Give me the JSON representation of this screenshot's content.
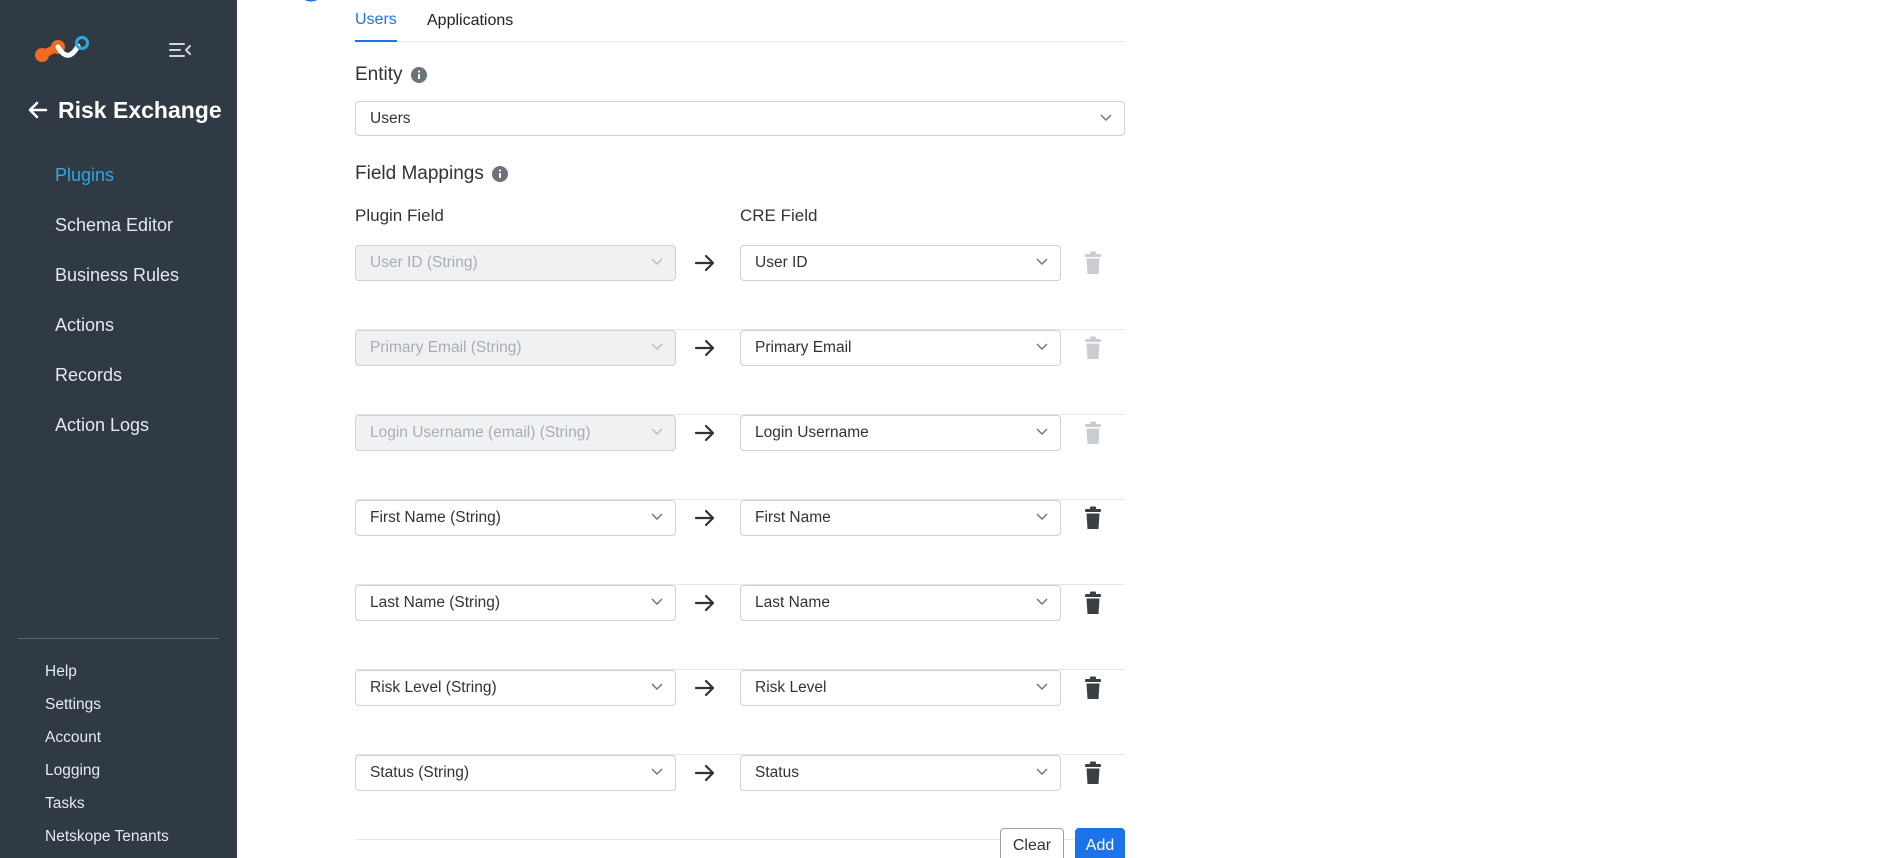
{
  "sidebar": {
    "section_title": "Risk Exchange",
    "nav_items": [
      {
        "label": "Plugins",
        "active": true
      },
      {
        "label": "Schema Editor",
        "active": false
      },
      {
        "label": "Business Rules",
        "active": false
      },
      {
        "label": "Actions",
        "active": false
      },
      {
        "label": "Records",
        "active": false
      },
      {
        "label": "Action Logs",
        "active": false
      }
    ],
    "footer_items": [
      "Help",
      "Settings",
      "Account",
      "Logging",
      "Tasks",
      "Netskope Tenants"
    ]
  },
  "tabs": [
    {
      "label": "Users",
      "active": true
    },
    {
      "label": "Applications",
      "active": false
    }
  ],
  "entity": {
    "label": "Entity",
    "value": "Users"
  },
  "field_mappings": {
    "label": "Field Mappings",
    "plugin_field_header": "Plugin Field",
    "cre_field_header": "CRE Field",
    "rows": [
      {
        "plugin": "User ID (String)",
        "cre": "User ID",
        "locked": true
      },
      {
        "plugin": "Primary Email (String)",
        "cre": "Primary Email",
        "locked": true
      },
      {
        "plugin": "Login Username (email) (String)",
        "cre": "Login Username",
        "locked": true
      },
      {
        "plugin": "First Name (String)",
        "cre": "First Name",
        "locked": false
      },
      {
        "plugin": "Last Name (String)",
        "cre": "Last Name",
        "locked": false
      },
      {
        "plugin": "Risk Level (String)",
        "cre": "Risk Level",
        "locked": false
      },
      {
        "plugin": "Status (String)",
        "cre": "Status",
        "locked": false
      }
    ]
  },
  "buttons": {
    "clear": "Clear",
    "add": "Add"
  },
  "colors": {
    "sidebar_bg": "#2f3a45",
    "active_nav": "#2ea7e0",
    "accent_blue": "#1a73e8"
  }
}
